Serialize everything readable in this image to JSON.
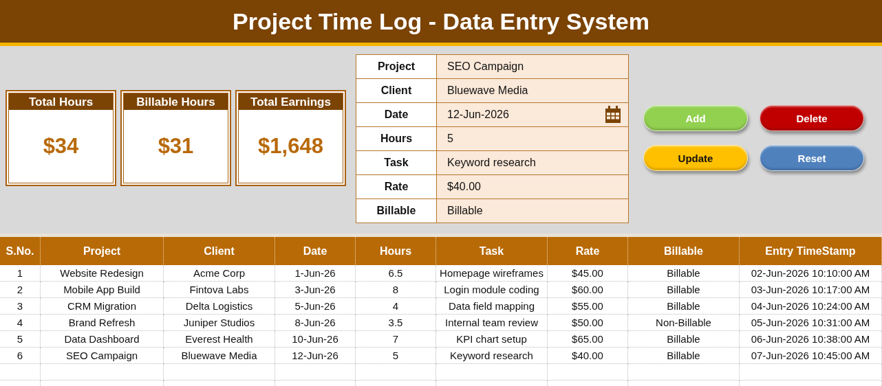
{
  "title": "Project Time Log - Data Entry System",
  "cards": [
    {
      "label": "Total Hours",
      "value": "$34"
    },
    {
      "label": "Billable Hours",
      "value": "$31"
    },
    {
      "label": "Total Earnings",
      "value": "$1,648"
    }
  ],
  "form": [
    {
      "label": "Project",
      "value": "SEO Campaign",
      "kind": "text"
    },
    {
      "label": "Client",
      "value": "Bluewave Media",
      "kind": "text"
    },
    {
      "label": "Date",
      "value": "12-Jun-2026",
      "kind": "date"
    },
    {
      "label": "Hours",
      "value": "5",
      "kind": "text"
    },
    {
      "label": "Task",
      "value": "Keyword research",
      "kind": "text"
    },
    {
      "label": "Rate",
      "value": "$40.00",
      "kind": "text"
    },
    {
      "label": "Billable",
      "value": "Billable",
      "kind": "text"
    }
  ],
  "buttons": [
    {
      "label": "Add",
      "color": "#92d050"
    },
    {
      "label": "Delete",
      "color": "#c00000"
    },
    {
      "label": "Update",
      "color": "#ffc000"
    },
    {
      "label": "Reset",
      "color": "#4f81bd"
    }
  ],
  "table": {
    "columns": [
      "S.No.",
      "Project",
      "Client",
      "Date",
      "Hours",
      "Task",
      "Rate",
      "Billable",
      "Entry TimeStamp"
    ],
    "rows": [
      [
        "1",
        "Website Redesign",
        "Acme Corp",
        "1-Jun-26",
        "6.5",
        "Homepage wireframes",
        "$45.00",
        "Billable",
        "02-Jun-2026 10:10:00 AM"
      ],
      [
        "2",
        "Mobile App Build",
        "Fintova Labs",
        "3-Jun-26",
        "8",
        "Login module coding",
        "$60.00",
        "Billable",
        "03-Jun-2026 10:17:00 AM"
      ],
      [
        "3",
        "CRM Migration",
        "Delta Logistics",
        "5-Jun-26",
        "4",
        "Data field mapping",
        "$55.00",
        "Billable",
        "04-Jun-2026 10:24:00 AM"
      ],
      [
        "4",
        "Brand Refresh",
        "Juniper Studios",
        "8-Jun-26",
        "3.5",
        "Internal team review",
        "$50.00",
        "Non-Billable",
        "05-Jun-2026 10:31:00 AM"
      ],
      [
        "5",
        "Data Dashboard",
        "Everest Health",
        "10-Jun-26",
        "7",
        "KPI chart setup",
        "$65.00",
        "Billable",
        "06-Jun-2026 10:38:00 AM"
      ],
      [
        "6",
        "SEO Campaign",
        "Bluewave Media",
        "12-Jun-26",
        "5",
        "Keyword research",
        "$40.00",
        "Billable",
        "07-Jun-2026 10:45:00 AM"
      ]
    ]
  }
}
